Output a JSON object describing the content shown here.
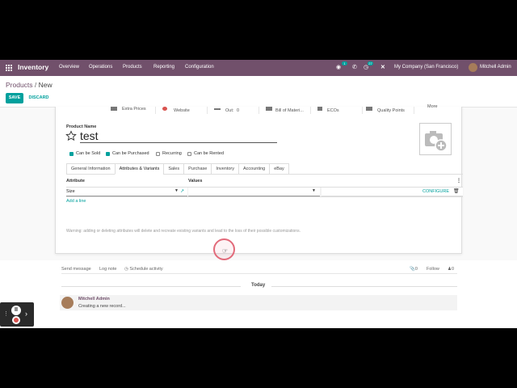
{
  "navbar": {
    "app_name": "Inventory",
    "menus": [
      "Overview",
      "Operations",
      "Products",
      "Reporting",
      "Configuration"
    ],
    "chat_badge": "1",
    "activity_badge": "27",
    "company": "My Company (San Francisco)",
    "user": "Mitchell Admin",
    "brand_color": "#71506b"
  },
  "control": {
    "breadcrumb_parent": "Products",
    "breadcrumb_sep": "/",
    "breadcrumb_current": "New",
    "save_label": "SAVE",
    "discard_label": "DISCARD"
  },
  "smart_buttons": [
    "Extra Prices",
    "Website",
    "Out:",
    "0",
    "Bill of Materi...",
    "ECOs",
    "Quality Points",
    "More"
  ],
  "form": {
    "name_label": "Product Name",
    "name_value": "test",
    "checkboxes": [
      {
        "label": "Can be Sold",
        "checked": true
      },
      {
        "label": "Can be Purchased",
        "checked": true
      },
      {
        "label": "Recurring",
        "checked": false
      },
      {
        "label": "Can be Rented",
        "checked": false
      }
    ],
    "tabs": [
      "General Information",
      "Attributes & Variants",
      "Sales",
      "Purchase",
      "Inventory",
      "Accounting",
      "eBay"
    ],
    "active_tab": "Attributes & Variants"
  },
  "attributes": {
    "col_attribute": "Attribute",
    "col_values": "Values",
    "row_attribute": "Size",
    "configure_label": "CONFIGURE",
    "add_line": "Add a line",
    "warning": "Warning: adding or deleting attributes will delete and recreate existing variants and lead to the loss of their possible customizations."
  },
  "chatter": {
    "send_message": "Send message",
    "log_note": "Log note",
    "schedule": "Schedule activity",
    "attachments": "0",
    "follow": "Follow",
    "followers": "0",
    "today": "Today",
    "author": "Mitchell Admin",
    "message": "Creating a new record..."
  },
  "accent_color": "#00a09d"
}
